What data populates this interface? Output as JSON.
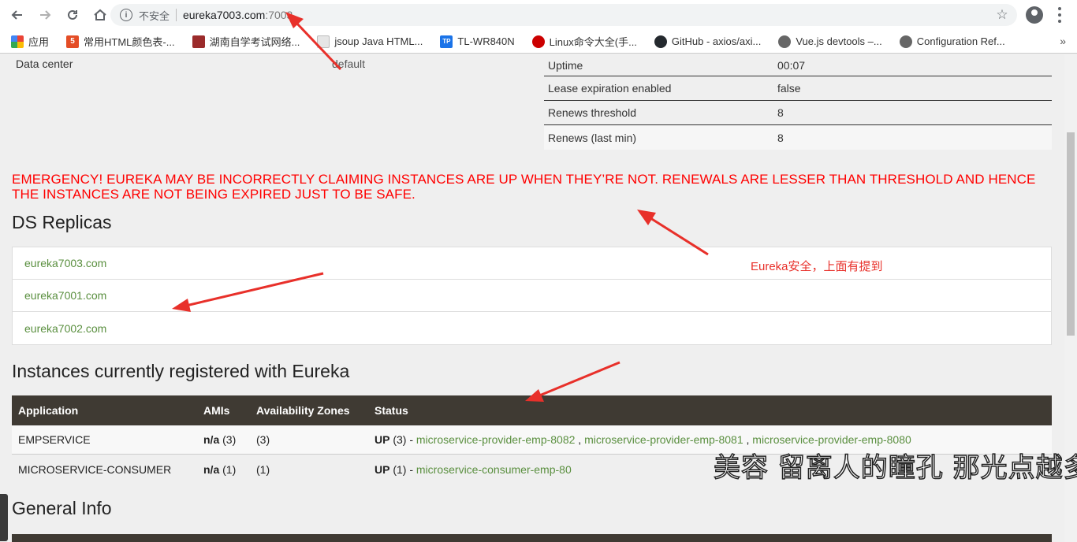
{
  "browser": {
    "security_label": "不安全",
    "url_host": "eureka7003.com",
    "url_port": ":7003",
    "bookmarks": [
      {
        "label": "应用",
        "icon": "apps-grid-icon",
        "color": "#4285f4"
      },
      {
        "label": "常用HTML颜色表-...",
        "icon": "html5-icon",
        "color": "#e44d26"
      },
      {
        "label": "湖南自学考试网络...",
        "icon": "site-icon",
        "color": "#9b2b2b"
      },
      {
        "label": "jsoup Java HTML...",
        "icon": "page-icon",
        "color": "#cfcfcf"
      },
      {
        "label": "TL-WR840N",
        "icon": "tp-link-icon",
        "color": "#1a73e8"
      },
      {
        "label": "Linux命令大全(手...",
        "icon": "redhat-icon",
        "color": "#cc0000"
      },
      {
        "label": "GitHub - axios/axi...",
        "icon": "github-icon",
        "color": "#24292e"
      },
      {
        "label": "Vue.js devtools –...",
        "icon": "globe-icon",
        "color": "#555555"
      },
      {
        "label": "Configuration Ref...",
        "icon": "globe-icon",
        "color": "#555555"
      }
    ],
    "more": "»"
  },
  "environment": {
    "label": "Data center",
    "value": "default"
  },
  "stats": [
    {
      "key": "Uptime",
      "value": "00:07"
    },
    {
      "key": "Lease expiration enabled",
      "value": "false"
    },
    {
      "key": "Renews threshold",
      "value": "8"
    },
    {
      "key": "Renews (last min)",
      "value": "8"
    }
  ],
  "emergency": "EMERGENCY! EUREKA MAY BE INCORRECTLY CLAIMING INSTANCES ARE UP WHEN THEY’RE NOT. RENEWALS ARE LESSER THAN THRESHOLD AND HENCE THE INSTANCES ARE NOT BEING EXPIRED JUST TO BE SAFE.",
  "ds_replicas": {
    "title": "DS Replicas",
    "items": [
      "eureka7003.com",
      "eureka7001.com",
      "eureka7002.com"
    ]
  },
  "annotation_note": "Eureka安全，上面有提到",
  "instances": {
    "title": "Instances currently registered with Eureka",
    "headers": [
      "Application",
      "AMIs",
      "Availability Zones",
      "Status"
    ],
    "rows": [
      {
        "app": "EMPSERVICE",
        "amis_na": "n/a",
        "amis_count": "(3)",
        "zones": "(3)",
        "status": "UP",
        "status_count": "(3) -",
        "links": [
          "microservice-provider-emp-8082",
          "microservice-provider-emp-8081",
          "microservice-provider-emp-8080"
        ]
      },
      {
        "app": "MICROSERVICE-CONSUMER",
        "amis_na": "n/a",
        "amis_count": "(1)",
        "zones": "(1)",
        "status": "UP",
        "status_count": "(1) -",
        "links": [
          "microservice-consumer-emp-80"
        ]
      }
    ]
  },
  "general_info": {
    "title": "General Info"
  },
  "overlay_caption": "美容 留离人的瞳孔 那光点越多",
  "colors": {
    "accent_link": "#5a8f3f",
    "table_header": "#3f3a33",
    "emergency": "#ff0000",
    "annotation": "#e8302a"
  }
}
